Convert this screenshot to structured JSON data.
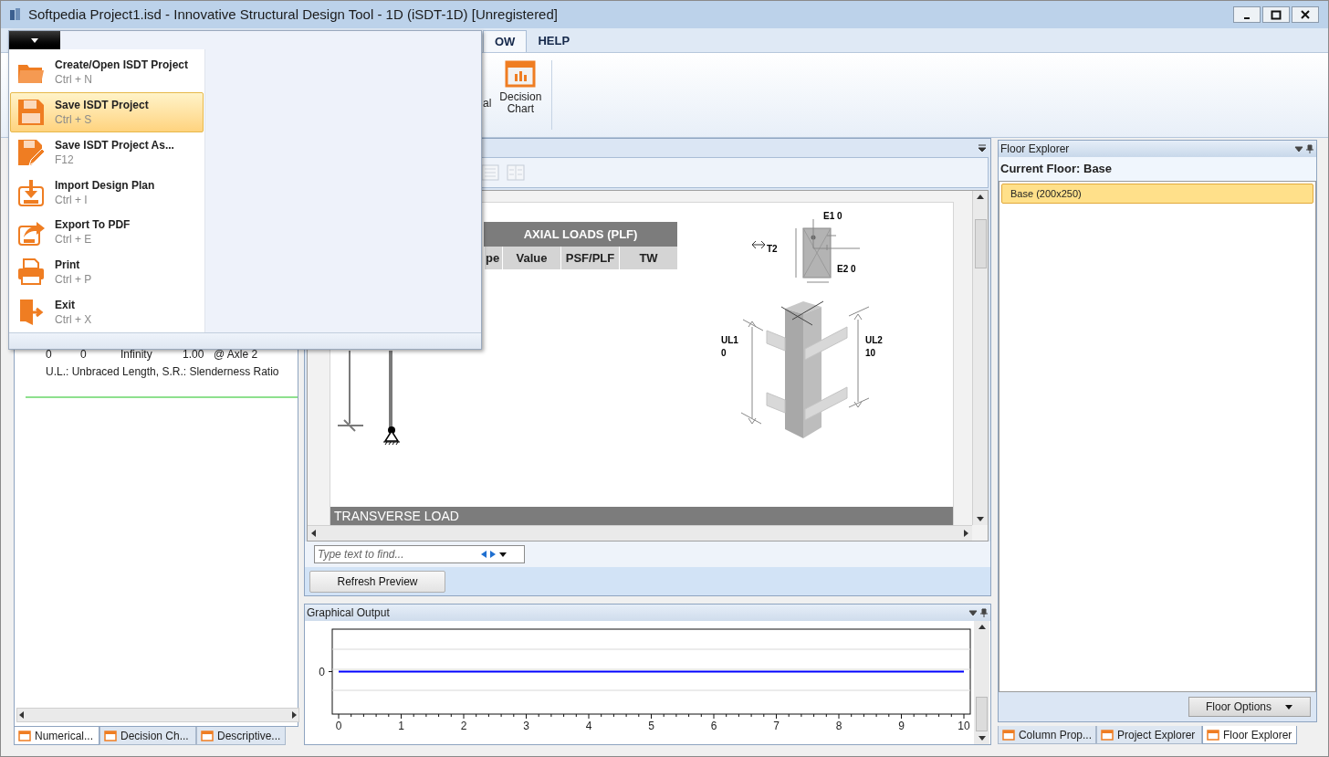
{
  "window": {
    "title": "Softpedia Project1.isd - Innovative Structural Design Tool - 1D (iSDT-1D) [Unregistered]"
  },
  "ribbon": {
    "tabs": [
      {
        "label": "OW",
        "selected": true
      },
      {
        "label": "HELP",
        "selected": false
      }
    ],
    "buttons": [
      {
        "label": "al",
        "kind": "cut"
      },
      {
        "label": "Decision Chart",
        "kind": "chart"
      }
    ]
  },
  "file_menu": {
    "items": [
      {
        "label": "Create/Open ISDT Project",
        "shortcut": "Ctrl + N",
        "kind": "open",
        "selected": false
      },
      {
        "label": "Save ISDT Project",
        "shortcut": "Ctrl + S",
        "kind": "save",
        "selected": true
      },
      {
        "label": "Save ISDT Project As...",
        "shortcut": "F12",
        "kind": "save_as",
        "selected": false
      },
      {
        "label": "Import Design Plan",
        "shortcut": "Ctrl + I",
        "kind": "import",
        "selected": false
      },
      {
        "label": "Export To PDF",
        "shortcut": "Ctrl + E",
        "kind": "export",
        "selected": false
      },
      {
        "label": "Print",
        "shortcut": "Ctrl + P",
        "kind": "print",
        "selected": false
      },
      {
        "label": "Exit",
        "shortcut": "Ctrl + X",
        "kind": "exit",
        "selected": false
      }
    ]
  },
  "left_panel": {
    "rows": [
      [
        "0",
        "0",
        "Infinity",
        "1.00",
        "@ Axle 2"
      ]
    ],
    "legend": "U.L.: Unbraced Length, S.R.: Slenderness Ratio",
    "tabs": [
      {
        "label": "Numerical...",
        "selected": true
      },
      {
        "label": "Decision Ch...",
        "selected": false
      },
      {
        "label": "Descriptive...",
        "selected": false
      }
    ]
  },
  "preview": {
    "table": {
      "title": "AXIAL LOADS (PLF)",
      "columns": [
        "pe",
        "Value",
        "PSF/PLF",
        "TW"
      ]
    },
    "diagram": {
      "e1": "E1 0",
      "t2": "T2",
      "e2": "E2 0",
      "ul1": "UL1",
      "ul1_value": "0",
      "ul2": "UL2",
      "ul2_value": "10"
    },
    "section_title": "TRANSVERSE LOAD",
    "search": {
      "placeholder": "Type text to find..."
    },
    "refresh_button": "Refresh Preview"
  },
  "graphical_output": {
    "title": "Graphical Output",
    "x_axis_labels": [
      "0",
      "1",
      "2",
      "3",
      "4",
      "5",
      "6",
      "7",
      "8",
      "9",
      "10"
    ],
    "y_axis_labels": [
      "0"
    ]
  },
  "floor_explorer": {
    "title": "Floor Explorer",
    "current_floor": "Current Floor: Base",
    "floors": [
      {
        "label": "Base (200x250)",
        "selected": true
      }
    ],
    "options_button": "Floor Options",
    "tabs": [
      {
        "label": "Column Prop...",
        "selected": false
      },
      {
        "label": "Project Explorer",
        "selected": false
      },
      {
        "label": "Floor Explorer",
        "selected": true
      }
    ]
  }
}
